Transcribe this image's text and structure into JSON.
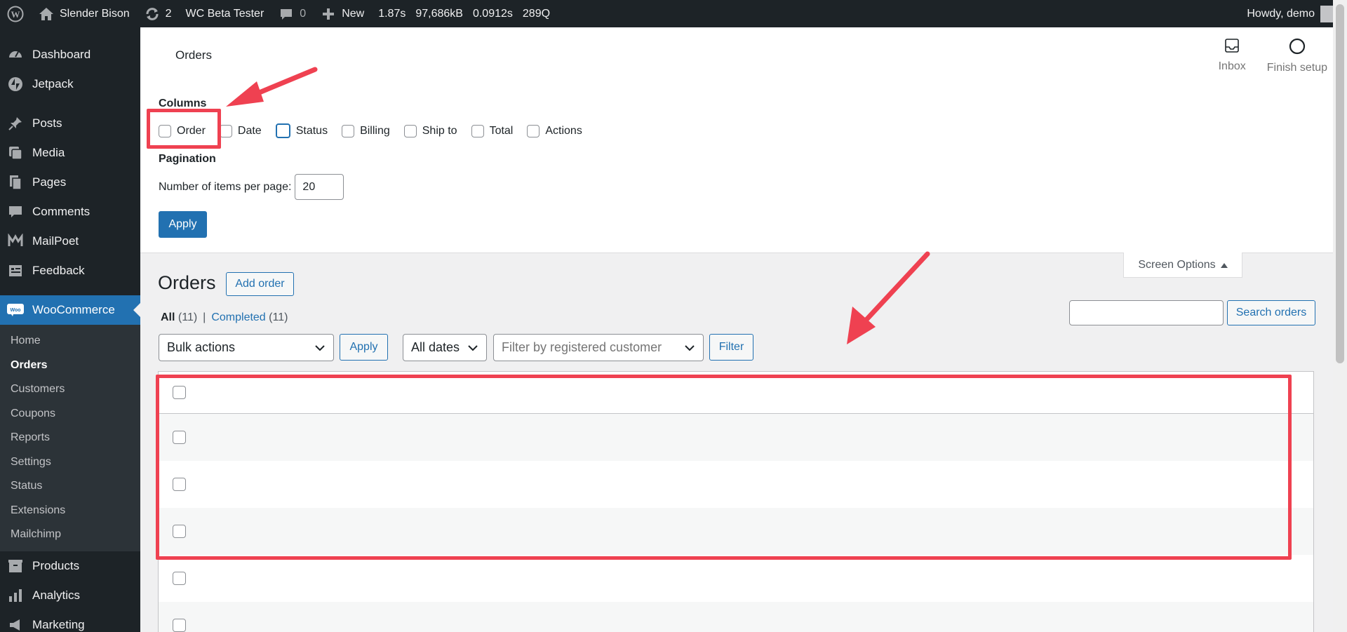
{
  "adminbar": {
    "site_name": "Slender Bison",
    "updates_count": "2",
    "beta_tester": "WC Beta Tester",
    "comments_count": "0",
    "new_label": "New",
    "perf": [
      "1.87s",
      "97,686kB",
      "0.0912s",
      "289Q"
    ],
    "howdy": "Howdy, demo"
  },
  "sidebar": {
    "items": [
      {
        "label": "Dashboard",
        "icon": "dashboard-icon"
      },
      {
        "label": "Jetpack",
        "icon": "jetpack-icon"
      },
      {
        "label": "Posts",
        "icon": "pin-icon"
      },
      {
        "label": "Media",
        "icon": "media-icon"
      },
      {
        "label": "Pages",
        "icon": "pages-icon"
      },
      {
        "label": "Comments",
        "icon": "comment-icon"
      },
      {
        "label": "MailPoet",
        "icon": "mailpoet-icon"
      },
      {
        "label": "Feedback",
        "icon": "feedback-icon"
      }
    ],
    "woocommerce": "WooCommerce",
    "woo_badge": "Woo",
    "submenu": [
      "Home",
      "Orders",
      "Customers",
      "Coupons",
      "Reports",
      "Settings",
      "Status",
      "Extensions",
      "Mailchimp"
    ],
    "submenu_active": "Orders",
    "bottom": [
      {
        "label": "Products",
        "icon": "products-icon"
      },
      {
        "label": "Analytics",
        "icon": "analytics-icon"
      },
      {
        "label": "Marketing",
        "icon": "marketing-icon"
      }
    ]
  },
  "wc_header": {
    "title": "Orders",
    "inbox": "Inbox",
    "finish_setup": "Finish setup"
  },
  "screen_options": {
    "columns_label": "Columns",
    "columns": [
      "Order",
      "Date",
      "Status",
      "Billing",
      "Ship to",
      "Total",
      "Actions"
    ],
    "pagination_label": "Pagination",
    "per_page_label": "Number of items per page:",
    "per_page_value": "20",
    "apply": "Apply",
    "toggle": "Screen Options"
  },
  "main": {
    "title": "Orders",
    "add_order": "Add order",
    "views": [
      {
        "label": "All",
        "count": "(11)"
      },
      {
        "label": "Completed",
        "count": "(11)"
      }
    ],
    "separator": "|",
    "search_button": "Search orders",
    "bulk_actions": "Bulk actions",
    "apply": "Apply",
    "all_dates": "All dates",
    "customer_placeholder": "Filter by registered customer",
    "filter": "Filter"
  },
  "colors": {
    "accent": "#2271b1",
    "admin_bg": "#1d2327",
    "annotation": "#ef4151"
  }
}
